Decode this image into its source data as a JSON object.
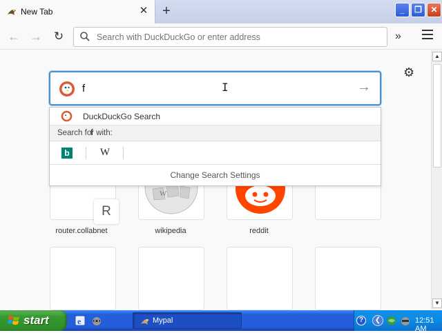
{
  "tab": {
    "title": "New Tab",
    "close": "✕",
    "new_tab": "+"
  },
  "window": {
    "minimize": "_",
    "maximize": "❐",
    "close": "✕"
  },
  "navbar": {
    "back": "←",
    "forward": "→",
    "reload": "↻",
    "url_placeholder": "Search with DuckDuckGo or enter address",
    "overflow": "»"
  },
  "content": {
    "settings_icon": "⚙",
    "search": {
      "value": "f",
      "go": "→"
    },
    "dropdown": {
      "engine_name": "DuckDuckGo Search",
      "search_for_prefix": "Search for ",
      "search_for_term": "f",
      "search_for_suffix": " with:",
      "bing_letter": "b",
      "wiki_letter": "W",
      "change_settings": "Change Search Settings"
    },
    "tiles": [
      {
        "label": "router.collabnet",
        "letter": "R"
      },
      {
        "label": "wikipedia"
      },
      {
        "label": "reddit"
      },
      {
        "label": ""
      }
    ]
  },
  "scrollbar": {
    "up": "▲",
    "down": "▼"
  },
  "taskbar": {
    "start": "start",
    "task_label": "Mypal",
    "clock": "12:51 AM",
    "help": "?",
    "back": "❮"
  },
  "colors": {
    "accent": "#4a90d9",
    "ddg": "#de5833",
    "reddit": "#ff4500",
    "bing": "#008373",
    "taskbar": "#245edb",
    "start": "#379a31"
  }
}
